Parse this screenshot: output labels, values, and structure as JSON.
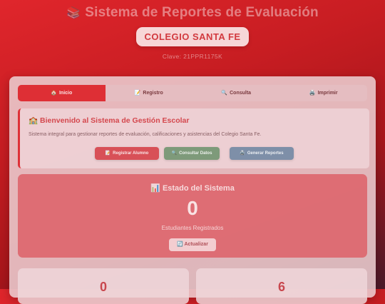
{
  "header": {
    "title_icon": "📚",
    "title": "Sistema de Reportes de Evaluación",
    "school": "COLEGIO SANTA FE",
    "clave": "Clave: 21PPR1175K"
  },
  "tabs": [
    {
      "icon": "🏠",
      "label": "Inicio",
      "active": true
    },
    {
      "icon": "📝",
      "label": "Registro",
      "active": false
    },
    {
      "icon": "🔍",
      "label": "Consulta",
      "active": false
    },
    {
      "icon": "🖨️",
      "label": "Imprimir",
      "active": false
    }
  ],
  "welcome": {
    "icon": "🏫",
    "title": "Bienvenido al Sistema de Gestión Escolar",
    "description": "Sistema integral para gestionar reportes de evaluación, calificaciones y asistencias del Colegio Santa Fe.",
    "buttons": {
      "register": {
        "icon": "📝",
        "label": "Registrar Alumno"
      },
      "consult": {
        "icon": "🔍",
        "label": "Consultar Datos"
      },
      "generate": {
        "icon": "🖨️",
        "label": "Generar Reportes"
      }
    }
  },
  "status": {
    "icon": "📊",
    "title": "Estado del Sistema",
    "count": "0",
    "label": "Estudiantes Registrados",
    "refresh": {
      "icon": "🔄",
      "label": "Actualizar"
    }
  },
  "stats": [
    {
      "value": "0"
    },
    {
      "value": "6"
    }
  ],
  "colors": {
    "accent": "#de2f35",
    "consult_button": "#7e9a7a",
    "generate_button": "#7e8fa8"
  }
}
